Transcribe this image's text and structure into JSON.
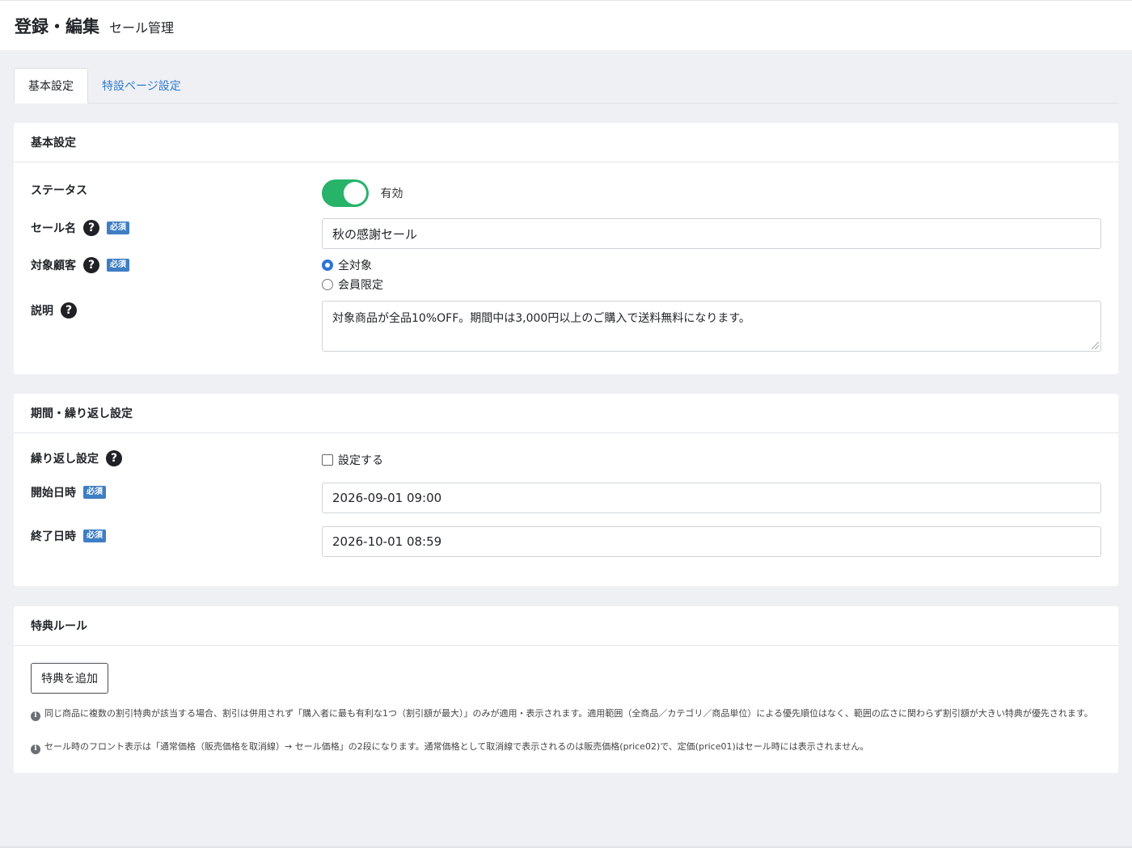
{
  "header": {
    "title": "登録・編集",
    "subtitle": "セール管理"
  },
  "tabs": [
    {
      "label": "基本設定",
      "active": true
    },
    {
      "label": "特設ページ設定",
      "active": false
    }
  ],
  "basic": {
    "title": "基本設定",
    "status": {
      "label": "ステータス",
      "value_text": "有効",
      "enabled": true
    },
    "sale_name": {
      "label": "セール名",
      "required": "必須",
      "value": "秋の感謝セール"
    },
    "target": {
      "label": "対象顧客",
      "required": "必須",
      "options": [
        "全対象",
        "会員限定"
      ],
      "selected": "全対象"
    },
    "description": {
      "label": "説明",
      "value": "対象商品が全品10%OFF。期間中は3,000円以上のご購入で送料無料になります。"
    }
  },
  "period": {
    "title": "期間・繰り返し設定",
    "repeat": {
      "label": "繰り返し設定",
      "checkbox_label": "設定する",
      "checked": false
    },
    "start": {
      "label": "開始日時",
      "required": "必須",
      "value": "2026-09-01 09:00"
    },
    "end": {
      "label": "終了日時",
      "required": "必須",
      "value": "2026-10-01 08:59"
    }
  },
  "benefit": {
    "title": "特典ルール",
    "add_button": "特典を追加",
    "notes": [
      "同じ商品に複数の割引特典が該当する場合、割引は併用されず「購入者に最も有利な1つ（割引額が最大）」のみが適用・表示されます。適用範囲（全商品／カテゴリ／商品単位）による優先順位はなく、範囲の広さに関わらず割引額が大きい特典が優先されます。",
      "セール時のフロント表示は「通常価格（販売価格を取消線）→ セール価格」の2段になります。通常価格として取消線で表示されるのは販売価格(price02)で、定価(price01)はセール時には表示されません。"
    ]
  },
  "icons": {
    "help": "question-circle-icon",
    "info": "info-circle-icon"
  },
  "colors": {
    "toggle_on": "#27b36a",
    "required_badge": "#3f7ec4",
    "link": "#2f7ad1"
  }
}
